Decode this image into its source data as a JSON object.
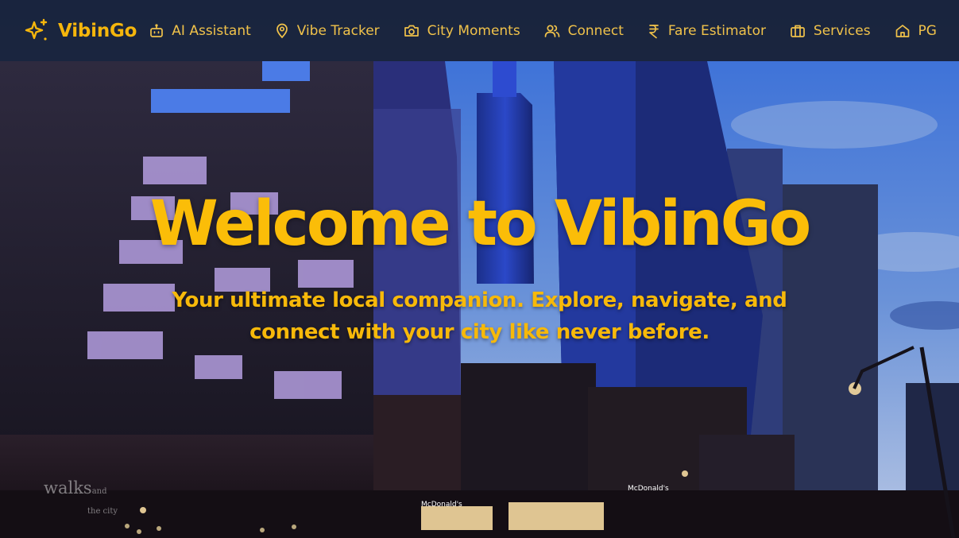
{
  "app": {
    "name": "VibinGo"
  },
  "nav": {
    "items": [
      {
        "label": "AI Assistant",
        "icon": "bot-icon"
      },
      {
        "label": "Vibe Tracker",
        "icon": "map-pin-icon"
      },
      {
        "label": "City Moments",
        "icon": "camera-icon"
      },
      {
        "label": "Connect",
        "icon": "users-icon"
      },
      {
        "label": "Fare Estimator",
        "icon": "rupee-icon"
      },
      {
        "label": "Services",
        "icon": "briefcase-icon"
      },
      {
        "label": "PG",
        "icon": "home-icon"
      }
    ]
  },
  "hero": {
    "title": "Welcome to VibinGo",
    "subtitle": "Your ultimate local companion. Explore, navigate, and connect with your city like never before."
  },
  "background": {
    "watermark_main": "walks",
    "watermark_small": "and",
    "watermark_line2": "the city",
    "storefront_1": "McDonald's",
    "storefront_2": "McDonald's"
  },
  "colors": {
    "accent": "#fbbd08",
    "navbar": "#172034",
    "sky": "#4b78c9"
  }
}
